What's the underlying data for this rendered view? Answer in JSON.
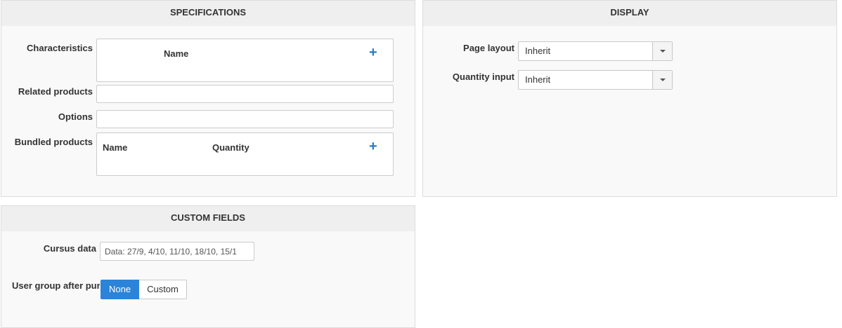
{
  "specifications": {
    "title": "SPECIFICATIONS",
    "characteristics": {
      "label": "Characteristics",
      "col_name": "Name",
      "add": "+"
    },
    "related_products": {
      "label": "Related products",
      "value": ""
    },
    "options": {
      "label": "Options",
      "value": ""
    },
    "bundled_products": {
      "label": "Bundled products",
      "col_name": "Name",
      "col_quantity": "Quantity",
      "add": "+"
    }
  },
  "display": {
    "title": "DISPLAY",
    "page_layout": {
      "label": "Page layout",
      "value": "Inherit"
    },
    "quantity_input": {
      "label": "Quantity input",
      "value": "Inherit"
    }
  },
  "custom_fields": {
    "title": "CUSTOM FIELDS",
    "cursus_data": {
      "label": "Cursus data",
      "value": "Data: 27/9, 4/10, 11/10, 18/10, 15/1"
    },
    "user_group": {
      "label": "User group after pur",
      "options": [
        "None",
        "Custom"
      ],
      "selected": "None"
    }
  },
  "colors": {
    "accent": "#2b84d9",
    "plus": "#2a7bc4",
    "header_bg": "#efefef",
    "panel_bg": "#f9f9f9"
  }
}
